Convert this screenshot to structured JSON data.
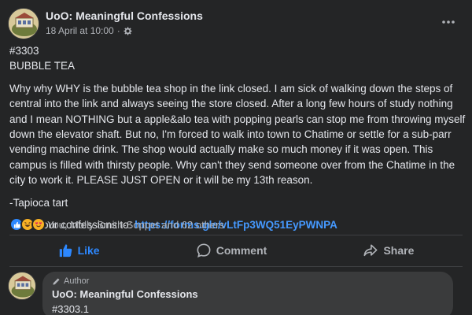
{
  "post": {
    "page_name": "UoO: Meaningful Confessions",
    "date": "18 April at 10:00",
    "audience_icon": "gear-icon",
    "more_icon": "more-options-icon",
    "number": "#3303",
    "title": "BUBBLE TEA",
    "body": "Why why WHY is the bubble tea shop in the link closed. I am sick of walking down the steps of central into the link and always seeing the store closed. After a long few hours of study nothing and I mean NOTHING but a apple&alo tea with popping pearls can stop me from throwing myself down the elevator shaft. But no, I'm forced to walk into town to Chatime or settle for a sub-parr vending machine drink. The shop would actually make so much money if it was open. This campus is filled with thirsty people. Why can't they send someone over from the Chatime in the city to work it. PLEASE JUST OPEN or it will be my 13th reason.",
    "signature": "-Tapioca tart",
    "send_label": "Send your confessions to: ",
    "send_link": "https://forms.gle/vLtFp3WQ51EyPWNPA"
  },
  "reactions": {
    "icons": [
      "like-reaction-icon",
      "haha-reaction-icon",
      "love-reaction-icon"
    ],
    "summary": "You, Molly Smith-Soppet and 62 others"
  },
  "actions": {
    "like": "Like",
    "comment": "Comment",
    "share": "Share"
  },
  "comment": {
    "badge": "Author",
    "name": "UoO: Meaningful Confessions",
    "text": "#3303.1"
  },
  "colors": {
    "background": "#242526",
    "text": "#e4e6eb",
    "secondary": "#b0b3b8",
    "link": "#4599ff",
    "like_blue": "#2d88ff"
  }
}
